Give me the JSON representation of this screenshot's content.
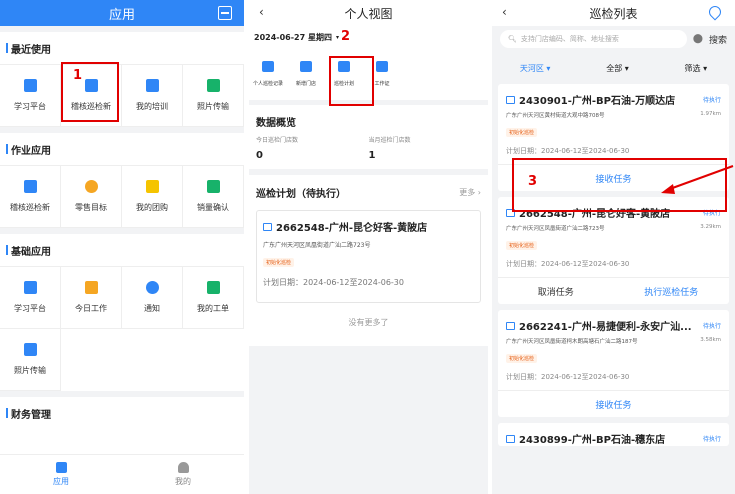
{
  "screen1": {
    "title": "应用",
    "sections": [
      {
        "name": "最近使用",
        "items": [
          "学习平台",
          "稽核巡检新",
          "我的培训",
          "照片传输"
        ]
      },
      {
        "name": "作业应用",
        "items": [
          "稽核巡检新",
          "零售目标",
          "我的团购",
          "销量确认"
        ]
      },
      {
        "name": "基础应用",
        "items": [
          "学习平台",
          "今日工作",
          "通知",
          "我的工单",
          "照片传输"
        ]
      },
      {
        "name": "财务管理",
        "items": []
      }
    ],
    "tabs": [
      "应用",
      "我的"
    ]
  },
  "screen2": {
    "title": "个人视图",
    "date": "2024-06-27 星期四",
    "quick": [
      "个人巡检记录",
      "新增门店",
      "巡检计划",
      "工作证"
    ],
    "overview_title": "数据概览",
    "stats": [
      {
        "label": "今日巡检门店数",
        "value": "0"
      },
      {
        "label": "当月巡检门店数",
        "value": "1"
      }
    ],
    "plan_title": "巡检计划（待执行）",
    "more": "更多",
    "plan": {
      "name": "2662548-广州-昆仑好客-黄陂店",
      "address": "广东广州天河区凤凰街道广汕二路723号",
      "tag": "初始化巡检",
      "date": "计划日期：2024-06-12至2024-06-30"
    },
    "no_more": "没有更多了"
  },
  "screen3": {
    "title": "巡检列表",
    "search_placeholder": "支持门店编码、简称、地址搜索",
    "search_btn": "搜索",
    "filters": [
      "天河区",
      "全部",
      "筛选"
    ],
    "tasks": [
      {
        "name": "2430901-广州-BP石油-万顺达店",
        "status": "待执行",
        "address": "广东广州天河区黄村街道大观中路708号",
        "distance": "1.97km",
        "tag": "初始化巡检",
        "date": "计划日期：2024-06-12至2024-06-30",
        "action": "接收任务"
      },
      {
        "name": "2662548-广州-昆仑好客-黄陂店",
        "status": "待执行",
        "address": "广东广州天河区凤凰街道广汕二路723号",
        "distance": "3.29km",
        "tag": "初始化巡检",
        "date": "计划日期：2024-06-12至2024-06-30",
        "cancel": "取消任务",
        "execute": "执行巡检任务"
      },
      {
        "name": "2662241-广州-易捷便利-永安广汕...",
        "status": "待执行",
        "address": "广东广州天河区凤凰街道柯木朗高塘石广汕二路187号",
        "distance": "3.58km",
        "tag": "初始化巡检",
        "date": "计划日期：2024-06-12至2024-06-30",
        "action": "接收任务"
      },
      {
        "name": "2430899-广州-BP石油-穗东店",
        "status": "待执行"
      }
    ]
  },
  "annotations": [
    "1",
    "2",
    "3"
  ],
  "colors": {
    "primary": "#2f86f6",
    "annotation": "#e10000"
  }
}
